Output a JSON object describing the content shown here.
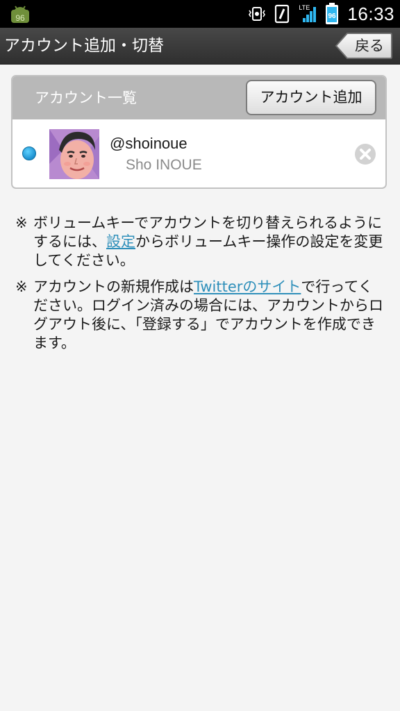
{
  "status_bar": {
    "app_icon_label": "96",
    "battery_level": "96",
    "network_type": "LTE",
    "time": "16:33",
    "icons": [
      "notification-app-icon",
      "vibrate-icon",
      "nfc-icon",
      "signal-icon",
      "battery-icon"
    ]
  },
  "header": {
    "title": "アカウント追加・切替",
    "back_label": "戻る"
  },
  "account_panel": {
    "title": "アカウント一覧",
    "add_button_label": "アカウント追加",
    "accounts": [
      {
        "handle": "@shoinoue",
        "name": "Sho INOUE",
        "selected": true
      }
    ]
  },
  "notes": {
    "mark": "※",
    "note1_before": "ボリュームキーでアカウントを切り替えられるようにするには、",
    "note1_link": "設定",
    "note1_after": "からボリュームキー操作の設定を変更してください。",
    "note2_before": "アカウントの新規作成は",
    "note2_link": "Twitterのサイト",
    "note2_after": "で行ってください。ログイン済みの場合には、アカウントからログアウト後に、「登録する」でアカウントを作成できます。"
  },
  "colors": {
    "header_bg": "#3a3a3a",
    "panel_header_bg": "#b8b8b8",
    "link": "#2e8fba",
    "selected_indicator": "#2aa7e6",
    "page_bg": "#f4f4f4"
  }
}
